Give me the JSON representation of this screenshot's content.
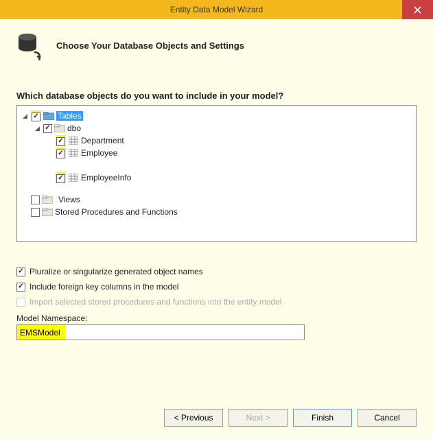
{
  "titlebar": {
    "title": "Entity Data Model Wizard"
  },
  "header": {
    "title": "Choose Your Database Objects and Settings"
  },
  "question": "Which database objects do you want to include in your model?",
  "tree": {
    "tables_label": "Tables",
    "dbo_label": "dbo",
    "dept_label": "Department",
    "emp_label": "Employee",
    "empinfo_label": "EmployeeInfo",
    "views_label": "Views",
    "sprocs_label": "Stored Procedures and Functions"
  },
  "options": {
    "pluralize": "Pluralize or singularize generated object names",
    "fk": "Include foreign key columns in the model",
    "import_sp": "Import selected stored procedures and functions into the entity model"
  },
  "namespace": {
    "label": "Model Namespace:",
    "value": "EMSModel"
  },
  "buttons": {
    "prev": "< Previous",
    "next": "Next >",
    "finish": "Finish",
    "cancel": "Cancel"
  }
}
